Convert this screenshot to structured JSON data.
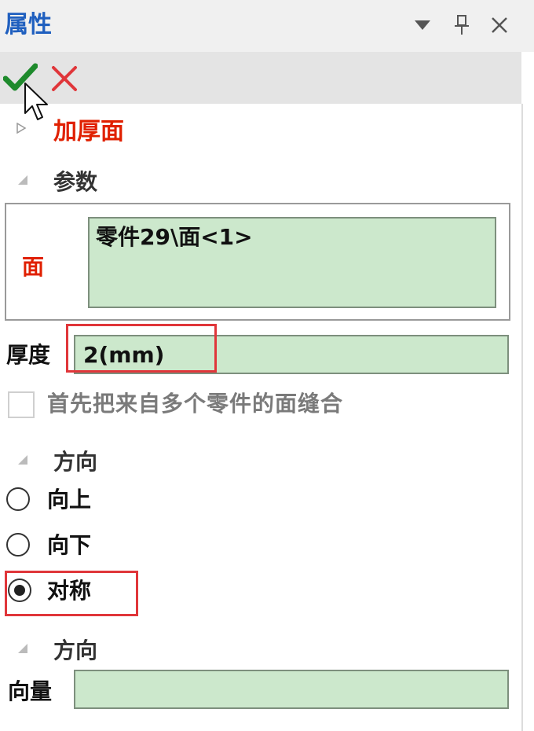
{
  "panel": {
    "title": "属性"
  },
  "feature": {
    "name": "加厚面"
  },
  "parameters": {
    "header": "参数",
    "face_label": "面",
    "face_items": [
      "零件29\\面<1>"
    ],
    "thickness_label": "厚度",
    "thickness_value": "2(mm)",
    "stitch_label": "首先把来自多个零件的面缝合",
    "stitch_checked": false
  },
  "direction": {
    "header": "方向",
    "options": [
      "向上",
      "向下",
      "对称"
    ],
    "selected": "对称"
  },
  "direction2": {
    "header": "方向",
    "vector_label": "向量",
    "vector_value": ""
  },
  "colors": {
    "title": "#1f5fbf",
    "accent_red": "#e02000",
    "ok_green": "#1e8a2c",
    "field_green": "#cce8cc",
    "highlight": "#e0363a"
  },
  "icons": {
    "dropdown": "triangle-down-icon",
    "pin": "pin-icon",
    "close": "close-icon",
    "ok": "checkmark-icon",
    "cancel": "cross-icon",
    "cursor": "mouse-cursor-icon"
  }
}
